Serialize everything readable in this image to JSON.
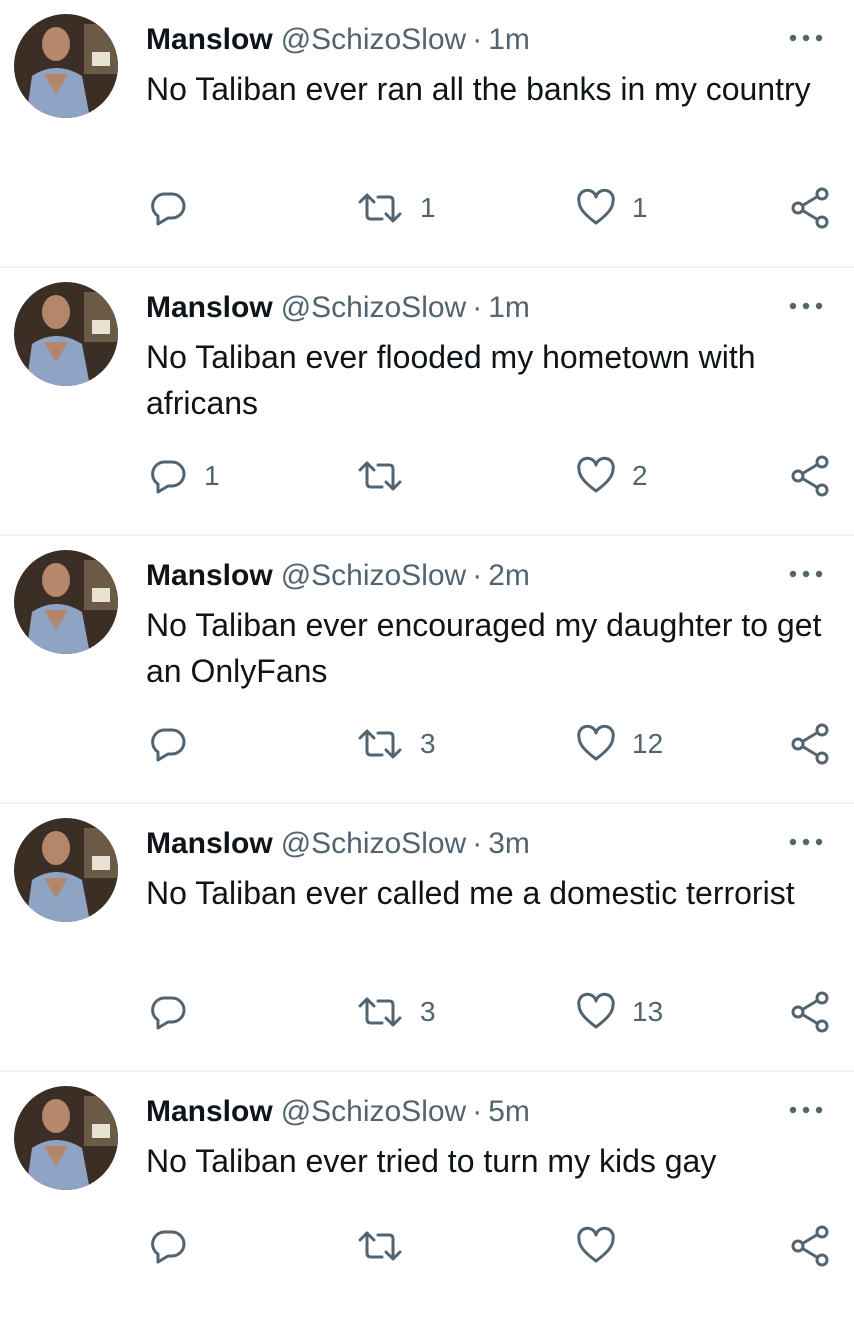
{
  "accent_color": "#536471",
  "tweets": [
    {
      "name": "Manslow",
      "handle": "@SchizoSlow",
      "separator": "·",
      "time": "1m",
      "text": "No Taliban ever ran all the banks in my country",
      "replies": "",
      "retweets": "1",
      "likes": "1"
    },
    {
      "name": "Manslow",
      "handle": "@SchizoSlow",
      "separator": "·",
      "time": "1m",
      "text": "No Taliban ever flooded my hometown with africans",
      "replies": "1",
      "retweets": "",
      "likes": "2"
    },
    {
      "name": "Manslow",
      "handle": "@SchizoSlow",
      "separator": "·",
      "time": "2m",
      "text": "No Taliban ever encouraged my daughter to get an OnlyFans",
      "replies": "",
      "retweets": "3",
      "likes": "12"
    },
    {
      "name": "Manslow",
      "handle": "@SchizoSlow",
      "separator": "·",
      "time": "3m",
      "text": "No Taliban ever called me a domestic terrorist",
      "replies": "",
      "retweets": "3",
      "likes": "13"
    },
    {
      "name": "Manslow",
      "handle": "@SchizoSlow",
      "separator": "·",
      "time": "5m",
      "text": "No Taliban ever tried to turn my kids gay",
      "replies": "",
      "retweets": "",
      "likes": ""
    }
  ]
}
